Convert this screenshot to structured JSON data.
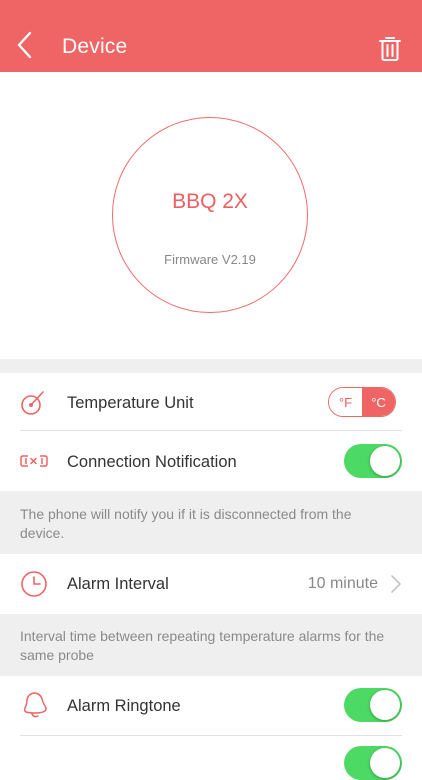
{
  "header": {
    "title": "Device"
  },
  "device": {
    "name": "BBQ 2X",
    "firmware": "Firmware V2.19"
  },
  "settings": {
    "temperature_unit": {
      "label": "Temperature Unit",
      "options": [
        "°F",
        "°C"
      ],
      "selected": "°C"
    },
    "connection_notification": {
      "label": "Connection Notification",
      "enabled": true,
      "note": "The phone will notify you if it is disconnected from the device."
    },
    "alarm_interval": {
      "label": "Alarm Interval",
      "value": "10 minute",
      "note": "Interval time between repeating temperature alarms for the same probe"
    },
    "alarm_ringtone": {
      "label": "Alarm Ringtone",
      "enabled": true
    }
  },
  "colors": {
    "accent": "#ef6464",
    "toggle_on": "#4cd964",
    "section_bg": "#efefef"
  }
}
